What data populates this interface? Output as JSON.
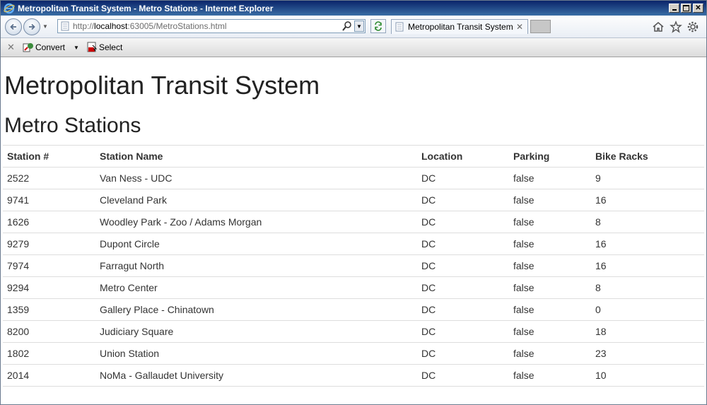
{
  "window": {
    "title": "Metropolitan Transit System - Metro Stations - Internet Explorer"
  },
  "address_bar": {
    "url_prefix": "http://",
    "url_host": "localhost",
    "url_rest": ":63005/MetroStations.html"
  },
  "tab": {
    "title": "Metropolitan Transit System ...",
    "close": "✕"
  },
  "command_bar": {
    "convert_label": "Convert",
    "select_label": "Select"
  },
  "page": {
    "heading": "Metropolitan Transit System",
    "subheading": "Metro Stations",
    "table": {
      "headers": [
        "Station #",
        "Station Name",
        "Location",
        "Parking",
        "Bike Racks"
      ],
      "rows": [
        [
          "2522",
          "Van Ness - UDC",
          "DC",
          "false",
          "9"
        ],
        [
          "9741",
          "Cleveland Park",
          "DC",
          "false",
          "16"
        ],
        [
          "1626",
          "Woodley Park - Zoo / Adams Morgan",
          "DC",
          "false",
          "8"
        ],
        [
          "9279",
          "Dupont Circle",
          "DC",
          "false",
          "16"
        ],
        [
          "7974",
          "Farragut North",
          "DC",
          "false",
          "16"
        ],
        [
          "9294",
          "Metro Center",
          "DC",
          "false",
          "8"
        ],
        [
          "1359",
          "Gallery Place - Chinatown",
          "DC",
          "false",
          "0"
        ],
        [
          "8200",
          "Judiciary Square",
          "DC",
          "false",
          "18"
        ],
        [
          "1802",
          "Union Station",
          "DC",
          "false",
          "23"
        ],
        [
          "2014",
          "NoMa - Gallaudet University",
          "DC",
          "false",
          "10"
        ]
      ]
    }
  },
  "icons": {
    "titlebar": "ie-logo-icon",
    "back": "back-arrow-icon",
    "forward": "forward-arrow-icon",
    "home": "home-icon",
    "favorites": "star-icon",
    "tools": "gear-icon"
  },
  "colors": {
    "titlebar_start": "#0a246a",
    "titlebar_end": "#3a6ea5",
    "table_border": "#dddddd"
  }
}
